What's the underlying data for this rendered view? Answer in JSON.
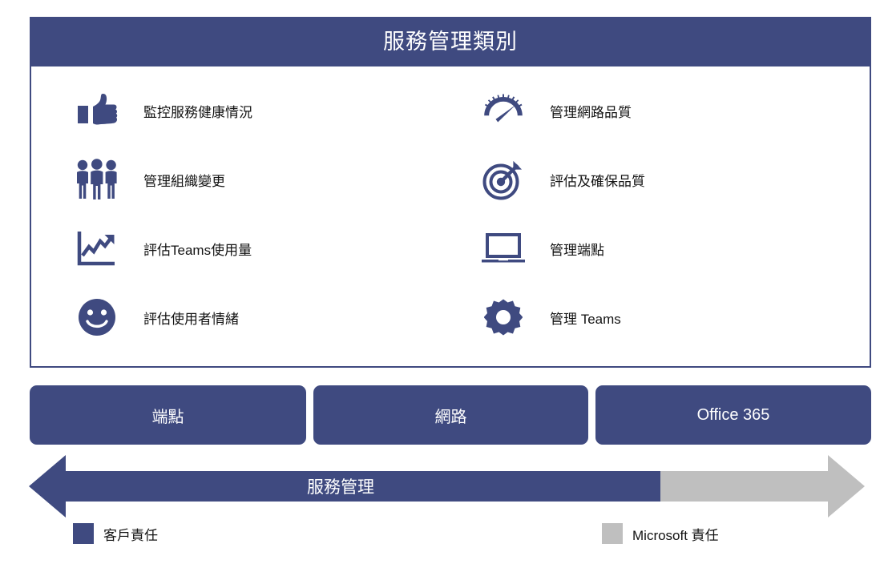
{
  "header": {
    "title": "服務管理類別"
  },
  "categories": {
    "left": [
      {
        "icon": "thumbs-up-icon",
        "label": "監控服務健康情況"
      },
      {
        "icon": "people-group-icon",
        "label": "管理組織變更"
      },
      {
        "icon": "line-chart-icon",
        "label": "評估Teams使用量"
      },
      {
        "icon": "smiley-face-icon",
        "label": "評估使用者情緒"
      }
    ],
    "right": [
      {
        "icon": "speedometer-icon",
        "label": "管理網路品質"
      },
      {
        "icon": "target-dart-icon",
        "label": "評估及確保品質"
      },
      {
        "icon": "laptop-icon",
        "label": "管理端點"
      },
      {
        "icon": "gear-icon",
        "label": "管理 Teams"
      }
    ]
  },
  "layers": [
    {
      "id": "endpoint",
      "label": "端點"
    },
    {
      "id": "network",
      "label": "網路"
    },
    {
      "id": "office365",
      "label": "Office 365"
    }
  ],
  "arrow": {
    "label": "服務管理"
  },
  "legend": [
    {
      "id": "customer",
      "label": "客戶責任",
      "color": "#3f4a80"
    },
    {
      "id": "microsoft",
      "label": "Microsoft 責任",
      "color": "#bfbfbf"
    }
  ],
  "colors": {
    "primary": "#3f4a80",
    "secondary": "#bfbfbf",
    "text": "#131313",
    "background": "#ffffff"
  }
}
